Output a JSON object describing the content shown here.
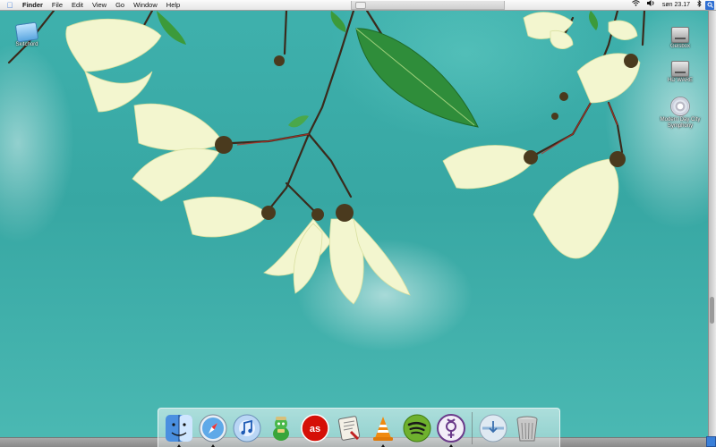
{
  "menubar": {
    "app_name": "Finder",
    "items": [
      "File",
      "Edit",
      "View",
      "Go",
      "Window",
      "Help"
    ],
    "clock": "søn 23.17",
    "status_icons": [
      "wifi-icon",
      "volume-icon",
      "bluetooth-icon"
    ]
  },
  "desktop_icons": [
    {
      "label": "Skitchord",
      "icon": "skitch-icon"
    },
    {
      "label": "Gelsbox",
      "icon": "hard-disk-icon"
    },
    {
      "label": "HD WARE",
      "icon": "hard-disk-icon"
    },
    {
      "label": "Modern Day City Symphony",
      "icon": "cd-icon"
    }
  ],
  "dock": {
    "apps": [
      {
        "name": "Finder",
        "icon": "finder-icon",
        "running": true
      },
      {
        "name": "Safari",
        "icon": "safari-icon",
        "running": true
      },
      {
        "name": "iTunes",
        "icon": "itunes-icon",
        "running": false
      },
      {
        "name": "Adium",
        "icon": "adium-icon",
        "running": false
      },
      {
        "name": "Last.fm",
        "icon": "lastfm-icon",
        "running": false
      },
      {
        "name": "Script",
        "icon": "script-icon",
        "running": false
      },
      {
        "name": "VLC",
        "icon": "vlc-icon",
        "running": true
      },
      {
        "name": "Spotify",
        "icon": "spotify-icon",
        "running": false
      },
      {
        "name": "Gender",
        "icon": "gender-icon",
        "running": true
      }
    ],
    "right_items": [
      {
        "name": "Downloads",
        "icon": "downloads-stack-icon"
      },
      {
        "name": "Trash",
        "icon": "trash-icon"
      }
    ]
  },
  "colors": {
    "wallpaper_sky": "#3aa8a4",
    "menubar_bg": "#f0f0f0",
    "selection_blue": "#2f6fd2"
  }
}
